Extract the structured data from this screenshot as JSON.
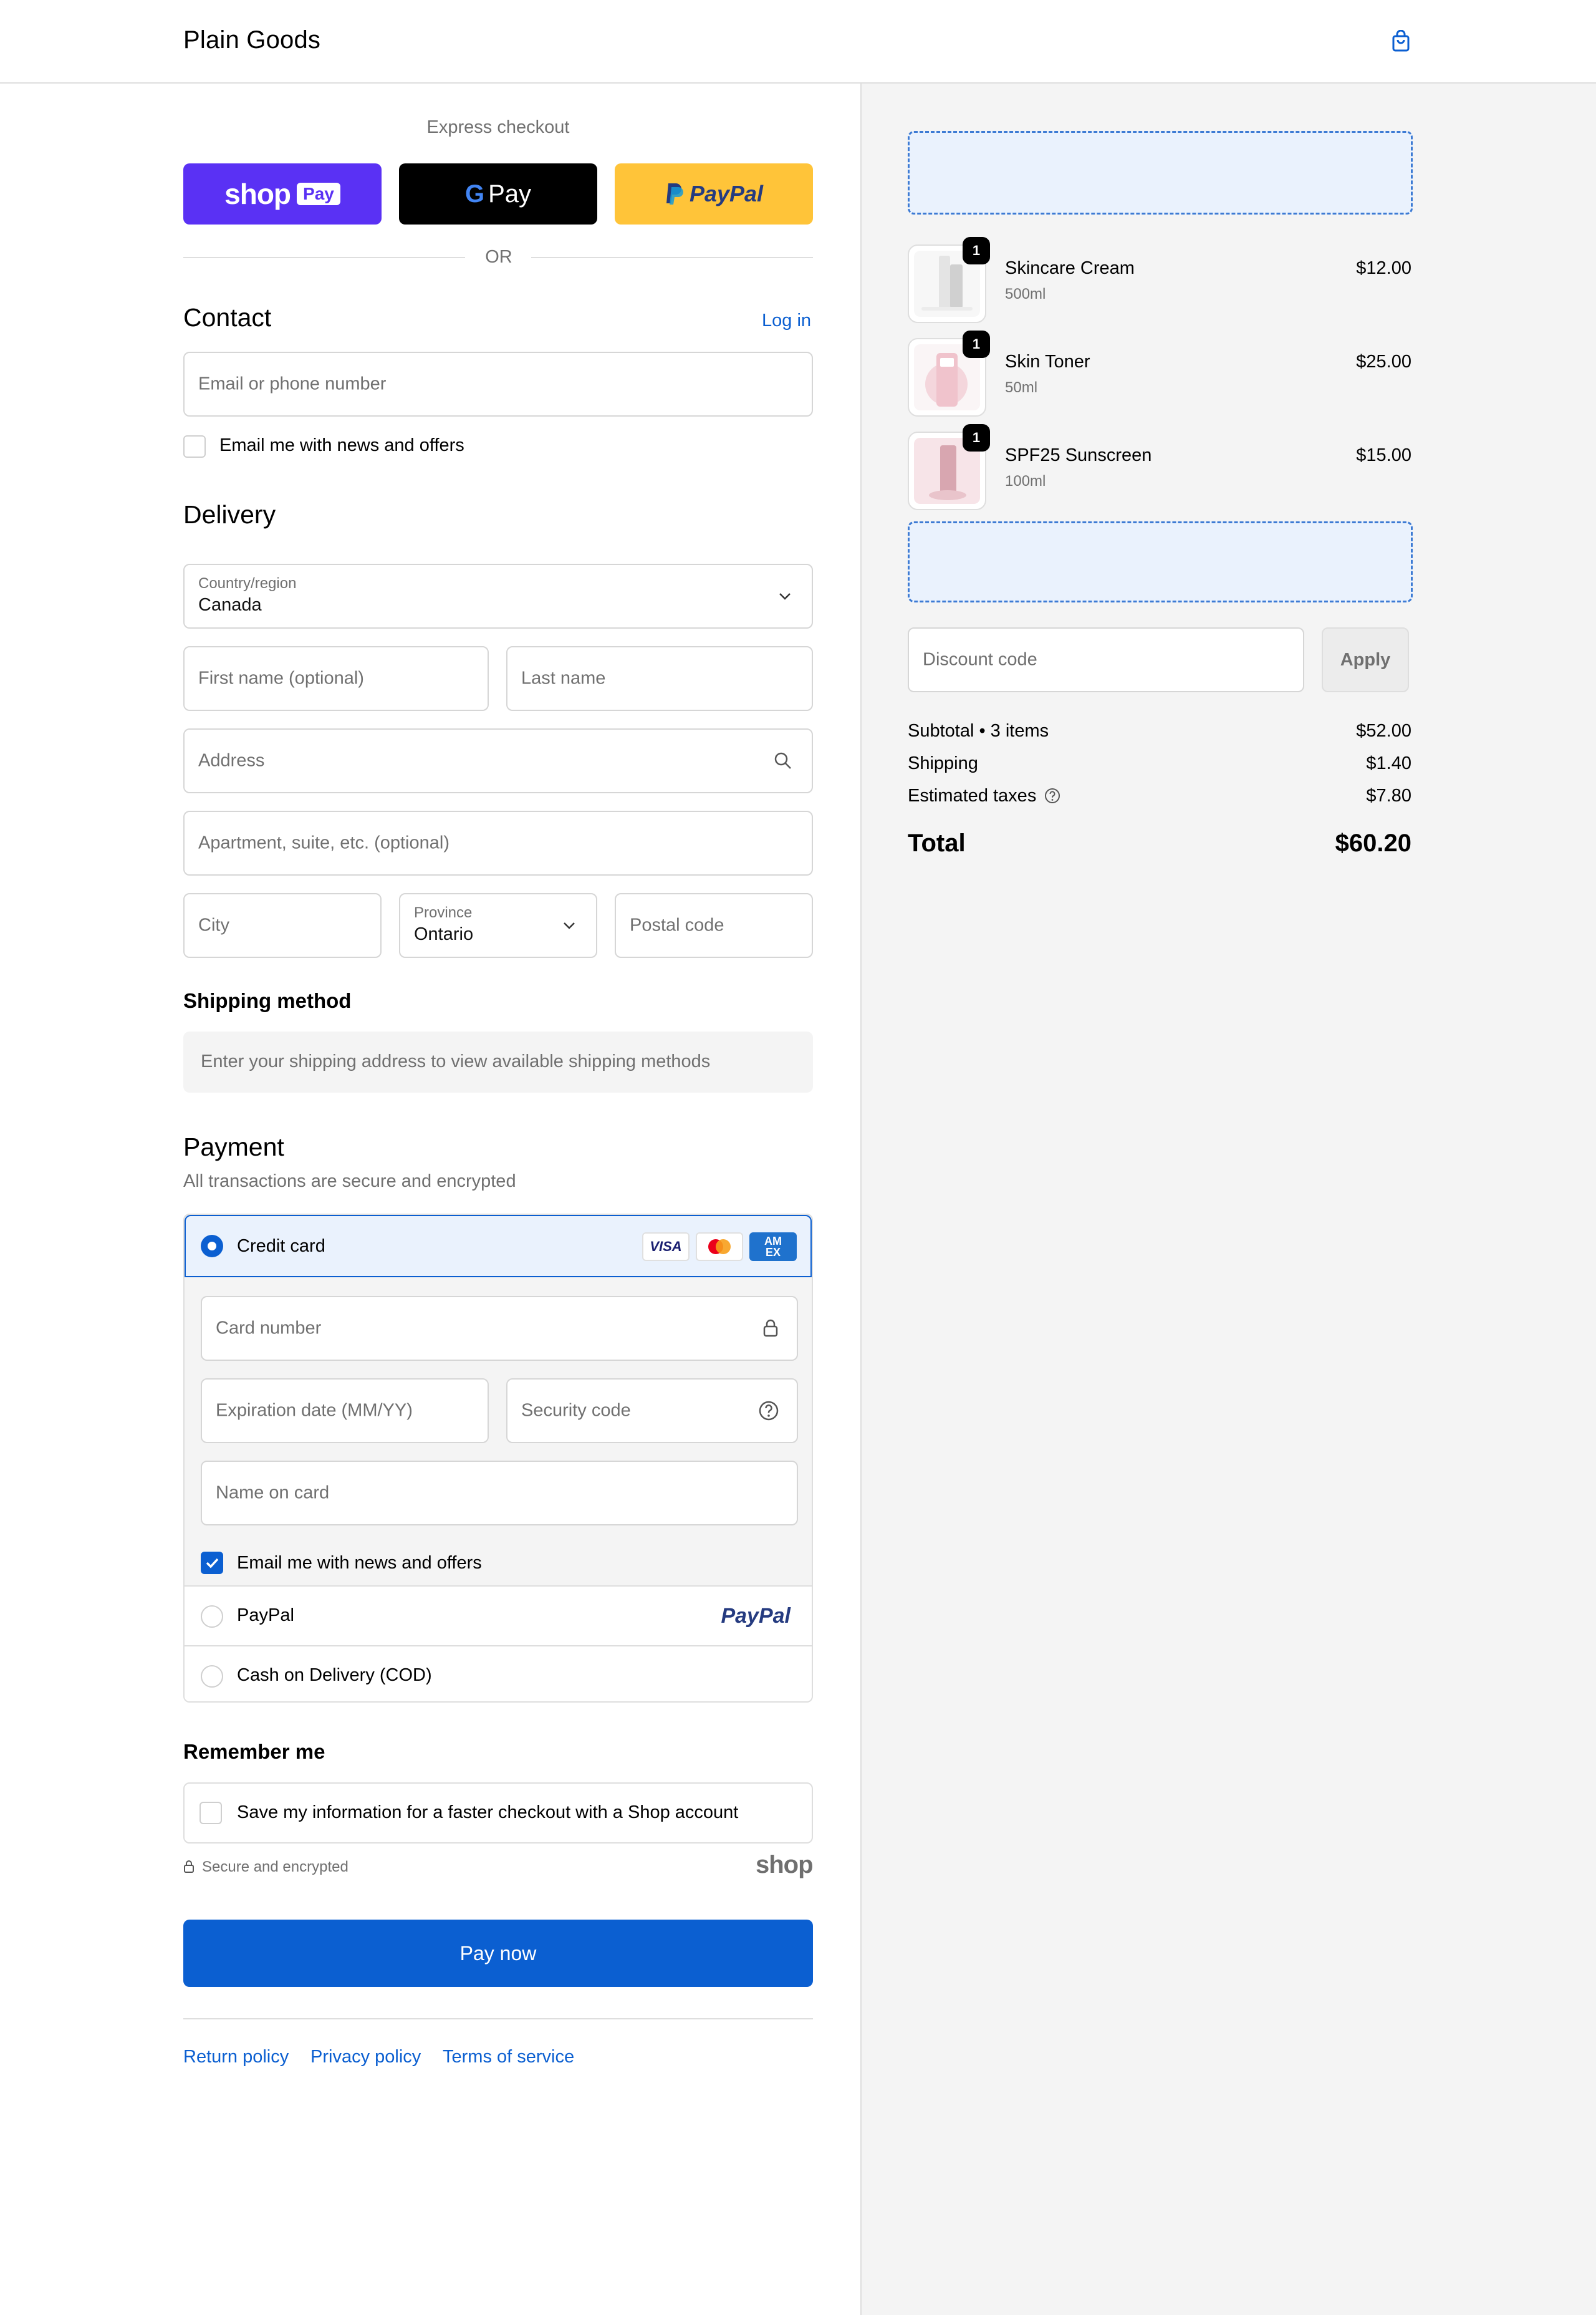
{
  "header": {
    "brand": "Plain Goods",
    "cart_icon": "shopping-bag-icon"
  },
  "express": {
    "title": "Express checkout",
    "shop_pay": {
      "wordmark": "shop",
      "badge": "Pay"
    },
    "google_pay": {
      "label": "Pay",
      "g": "G"
    },
    "paypal": "PayPal",
    "divider": "OR"
  },
  "contact": {
    "title": "Contact",
    "login": "Log in",
    "email_placeholder": "Email or phone number",
    "news_label": "Email me with news and offers"
  },
  "delivery": {
    "title": "Delivery",
    "country_label": "Country/region",
    "country_value": "Canada",
    "first_name_placeholder": "First name (optional)",
    "last_name_placeholder": "Last name",
    "address_placeholder": "Address",
    "apartment_placeholder": "Apartment, suite, etc. (optional)",
    "city_placeholder": "City",
    "province_label": "Province",
    "province_value": "Ontario",
    "postal_placeholder": "Postal code"
  },
  "shipping_method": {
    "title": "Shipping method",
    "notice": "Enter your shipping address to view available shipping methods"
  },
  "payment": {
    "title": "Payment",
    "subtitle": "All transactions are secure and encrypted",
    "credit_card": "Credit card",
    "card_logos": {
      "visa": "VISA",
      "amex": "AM EX"
    },
    "card_number_placeholder": "Card number",
    "expiration_placeholder": "Expiration date (MM/YY)",
    "security_placeholder": "Security code",
    "name_placeholder": "Name on card",
    "card_news_label": "Email me with news and offers",
    "paypal_label": "PayPal",
    "paypal_logo": "PayPal",
    "cod_label": "Cash on Delivery (COD)"
  },
  "remember": {
    "title": "Remember me",
    "save_label": "Save my information for a faster checkout with a Shop account",
    "secure_note": "Secure and encrypted",
    "shop_logo": "shop"
  },
  "pay_button": "Pay now",
  "footer_links": [
    "Return policy",
    "Privacy policy",
    "Terms of service"
  ],
  "summary": {
    "items": [
      {
        "name": "Skincare Cream",
        "variant": "500ml",
        "price": "$12.00",
        "qty": "1"
      },
      {
        "name": "Skin Toner",
        "variant": "50ml",
        "price": "$25.00",
        "qty": "1"
      },
      {
        "name": "SPF25 Sunscreen",
        "variant": "100ml",
        "price": "$15.00",
        "qty": "1"
      }
    ],
    "discount_placeholder": "Discount code",
    "apply": "Apply",
    "subtotal_label": "Subtotal • 3 items",
    "subtotal": "$52.00",
    "shipping_label": "Shipping",
    "shipping": "$1.40",
    "taxes_label": "Estimated taxes",
    "taxes": "$7.80",
    "total_label": "Total",
    "total": "$60.20"
  },
  "colors": {
    "accent": "#0b5fd1",
    "shop_purple": "#5a31f4",
    "paypal_yellow": "#ffc439"
  }
}
